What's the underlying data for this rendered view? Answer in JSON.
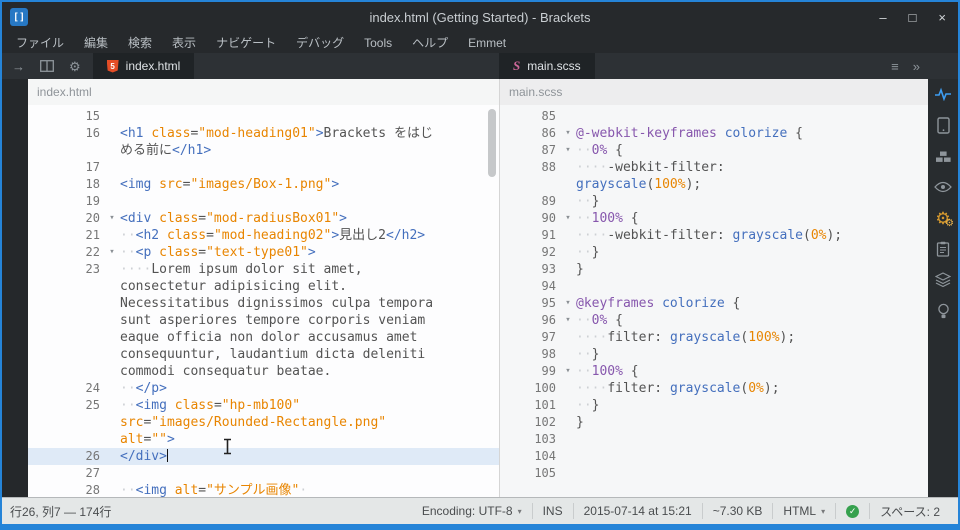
{
  "window": {
    "title": "index.html (Getting Started) - Brackets",
    "controls": {
      "minimize": "–",
      "maximize": "□",
      "close": "×"
    }
  },
  "menu": {
    "items": [
      "ファイル",
      "編集",
      "検索",
      "表示",
      "ナビゲート",
      "デバッグ",
      "Tools",
      "ヘルプ",
      "Emmet"
    ]
  },
  "tab_bar": {
    "left_tools": [
      {
        "name": "nav-forward-icon",
        "glyph": "→"
      },
      {
        "name": "split-view-icon",
        "glyph": "svg-split"
      },
      {
        "name": "settings-gear-icon",
        "glyph": "⚙"
      }
    ],
    "right_tools": [
      {
        "name": "working-files-list-icon",
        "glyph": "≡"
      },
      {
        "name": "overflow-chevrons-icon",
        "glyph": "»"
      }
    ]
  },
  "left_pane": {
    "tab_label": "index.html",
    "header_label": "index.html",
    "rows": [
      {
        "n": "15",
        "s": []
      },
      {
        "n": "16",
        "s": [
          [
            "<h1 ",
            "b"
          ],
          [
            "class",
            "o"
          ],
          [
            "=",
            "p"
          ],
          [
            "\"mod-heading01\"",
            "o"
          ],
          [
            ">",
            "b"
          ],
          [
            "Brackets をはじ",
            "p"
          ]
        ]
      },
      {
        "n": "",
        "s": [
          [
            "める前に",
            "p"
          ],
          [
            "</h1>",
            "b"
          ]
        ]
      },
      {
        "n": "17",
        "s": []
      },
      {
        "n": "18",
        "s": [
          [
            "<img ",
            "b"
          ],
          [
            "src",
            "o"
          ],
          [
            "=",
            "p"
          ],
          [
            "\"images/Box-1.png\"",
            "o"
          ],
          [
            ">",
            "b"
          ]
        ]
      },
      {
        "n": "19",
        "s": []
      },
      {
        "n": "20",
        "fold": 1,
        "s": [
          [
            "<div ",
            "b"
          ],
          [
            "class",
            "o"
          ],
          [
            "=",
            "p"
          ],
          [
            "\"mod-radiusBox01\"",
            "o"
          ],
          [
            ">",
            "b"
          ]
        ]
      },
      {
        "n": "21",
        "s": [
          [
            "··",
            "w"
          ],
          [
            "<h2 ",
            "b"
          ],
          [
            "class",
            "o"
          ],
          [
            "=",
            "p"
          ],
          [
            "\"mod-heading02\"",
            "o"
          ],
          [
            ">",
            "b"
          ],
          [
            "見出し2",
            "p"
          ],
          [
            "</h2>",
            "b"
          ]
        ]
      },
      {
        "n": "22",
        "fold": 1,
        "s": [
          [
            "··",
            "w"
          ],
          [
            "<p ",
            "b"
          ],
          [
            "class",
            "o"
          ],
          [
            "=",
            "p"
          ],
          [
            "\"text-type01\"",
            "o"
          ],
          [
            ">",
            "b"
          ]
        ]
      },
      {
        "n": "23",
        "s": [
          [
            "····",
            "w"
          ],
          [
            "Lorem ipsum dolor sit amet,",
            "p"
          ]
        ]
      },
      {
        "n": "",
        "s": [
          [
            "consectetur adipisicing elit.",
            "p"
          ]
        ]
      },
      {
        "n": "",
        "s": [
          [
            "Necessitatibus dignissimos culpa tempora",
            "p"
          ]
        ]
      },
      {
        "n": "",
        "s": [
          [
            "sunt asperiores tempore corporis veniam",
            "p"
          ]
        ]
      },
      {
        "n": "",
        "s": [
          [
            "eaque officia non dolor accusamus amet",
            "p"
          ]
        ]
      },
      {
        "n": "",
        "s": [
          [
            "consequuntur, laudantium dicta deleniti",
            "p"
          ]
        ]
      },
      {
        "n": "",
        "s": [
          [
            "commodi consequatur beatae.",
            "p"
          ]
        ]
      },
      {
        "n": "24",
        "s": [
          [
            "··",
            "w"
          ],
          [
            "</p>",
            "b"
          ]
        ]
      },
      {
        "n": "25",
        "s": [
          [
            "··",
            "w"
          ],
          [
            "<img ",
            "b"
          ],
          [
            "class",
            "o"
          ],
          [
            "=",
            "p"
          ],
          [
            "\"hp-mb100\"",
            "o"
          ]
        ]
      },
      {
        "n": "",
        "s": [
          [
            "src",
            "o"
          ],
          [
            "=",
            "p"
          ],
          [
            "\"images/Rounded-Rectangle.png\"",
            "o"
          ]
        ]
      },
      {
        "n": "",
        "s": [
          [
            "alt",
            "o"
          ],
          [
            "=",
            "p"
          ],
          [
            "\"\"",
            "o"
          ],
          [
            ">",
            "b"
          ]
        ]
      },
      {
        "n": "26",
        "active": 1,
        "caret": 1,
        "s": [
          [
            "</div>",
            "b"
          ]
        ]
      },
      {
        "n": "27",
        "s": []
      },
      {
        "n": "28",
        "s": [
          [
            "··",
            "w"
          ],
          [
            "<img ",
            "b"
          ],
          [
            "alt",
            "o"
          ],
          [
            "=",
            "p"
          ],
          [
            "\"サンプル画像\"",
            "o"
          ],
          [
            "·",
            "w"
          ]
        ]
      }
    ]
  },
  "right_pane": {
    "tab_label": "main.scss",
    "header_label": "main.scss",
    "rows": [
      {
        "n": "85",
        "s": []
      },
      {
        "n": "86",
        "fold": 1,
        "s": [
          [
            "@-webkit-keyframes",
            "v"
          ],
          [
            " ",
            "p"
          ],
          [
            "colorize",
            "b"
          ],
          [
            " {",
            "p"
          ]
        ]
      },
      {
        "n": "87",
        "fold": 1,
        "s": [
          [
            "··",
            "w"
          ],
          [
            "0%",
            "v"
          ],
          [
            " {",
            "p"
          ]
        ]
      },
      {
        "n": "88",
        "s": [
          [
            "····",
            "w"
          ],
          [
            "-webkit-filter:",
            "p"
          ]
        ]
      },
      {
        "n": "",
        "s": [
          [
            "grayscale",
            "b"
          ],
          [
            "(",
            "p"
          ],
          [
            "100%",
            "o"
          ],
          [
            ");",
            "p"
          ]
        ]
      },
      {
        "n": "89",
        "s": [
          [
            "··",
            "w"
          ],
          [
            "}",
            "p"
          ]
        ]
      },
      {
        "n": "90",
        "fold": 1,
        "s": [
          [
            "··",
            "w"
          ],
          [
            "100%",
            "v"
          ],
          [
            " {",
            "p"
          ]
        ]
      },
      {
        "n": "91",
        "s": [
          [
            "····",
            "w"
          ],
          [
            "-webkit-filter:",
            "p"
          ],
          [
            " ",
            "p"
          ],
          [
            "grayscale",
            "b"
          ],
          [
            "(",
            "p"
          ],
          [
            "0%",
            "o"
          ],
          [
            ");",
            "p"
          ]
        ]
      },
      {
        "n": "92",
        "s": [
          [
            "··",
            "w"
          ],
          [
            "}",
            "p"
          ]
        ]
      },
      {
        "n": "93",
        "s": [
          [
            "}",
            "p"
          ]
        ]
      },
      {
        "n": "94",
        "s": []
      },
      {
        "n": "95",
        "fold": 1,
        "s": [
          [
            "@keyframes",
            "v"
          ],
          [
            " ",
            "p"
          ],
          [
            "colorize",
            "b"
          ],
          [
            " {",
            "p"
          ]
        ]
      },
      {
        "n": "96",
        "fold": 1,
        "s": [
          [
            "··",
            "w"
          ],
          [
            "0%",
            "v"
          ],
          [
            " {",
            "p"
          ]
        ]
      },
      {
        "n": "97",
        "s": [
          [
            "····",
            "w"
          ],
          [
            "filter:",
            "p"
          ],
          [
            " ",
            "p"
          ],
          [
            "grayscale",
            "b"
          ],
          [
            "(",
            "p"
          ],
          [
            "100%",
            "o"
          ],
          [
            ");",
            "p"
          ]
        ]
      },
      {
        "n": "98",
        "s": [
          [
            "··",
            "w"
          ],
          [
            "}",
            "p"
          ]
        ]
      },
      {
        "n": "99",
        "fold": 1,
        "s": [
          [
            "··",
            "w"
          ],
          [
            "100%",
            "v"
          ],
          [
            " {",
            "p"
          ]
        ]
      },
      {
        "n": "100",
        "s": [
          [
            "····",
            "w"
          ],
          [
            "filter:",
            "p"
          ],
          [
            " ",
            "p"
          ],
          [
            "grayscale",
            "b"
          ],
          [
            "(",
            "p"
          ],
          [
            "0%",
            "o"
          ],
          [
            ");",
            "p"
          ]
        ]
      },
      {
        "n": "101",
        "s": [
          [
            "··",
            "w"
          ],
          [
            "}",
            "p"
          ]
        ]
      },
      {
        "n": "102",
        "s": [
          [
            "}",
            "p"
          ]
        ]
      },
      {
        "n": "103",
        "s": []
      },
      {
        "n": "104",
        "s": []
      },
      {
        "n": "105",
        "s": []
      }
    ]
  },
  "sidebar": {
    "icons": [
      {
        "name": "live-preview-pulse-icon",
        "type": "pulse"
      },
      {
        "name": "device-preview-icon",
        "type": "tablet"
      },
      {
        "name": "extensions-bricks-icon",
        "type": "bricks"
      },
      {
        "name": "visibility-eye-icon",
        "type": "eye"
      },
      {
        "name": "settings-gears-icon",
        "type": "gears"
      },
      {
        "name": "snippets-clipboard-icon",
        "type": "clipboard"
      },
      {
        "name": "layers-stack-icon",
        "type": "layers"
      },
      {
        "name": "hint-lightbulb-icon",
        "type": "bulb"
      }
    ]
  },
  "status_bar": {
    "position": "行26, 列7 — 174行",
    "items": [
      {
        "name": "encoding-selector",
        "label": "Encoding: UTF-8",
        "caret": true,
        "interactable": true
      },
      {
        "name": "insert-mode-indicator",
        "label": "INS",
        "interactable": true
      },
      {
        "name": "timestamp",
        "label": "2015-07-14 at 15:21",
        "interactable": false
      },
      {
        "name": "file-size",
        "label": "~7.30 KB",
        "interactable": false
      },
      {
        "name": "language-selector",
        "label": "HTML",
        "caret": true,
        "interactable": true
      },
      {
        "name": "lint-status",
        "check": true,
        "interactable": true
      },
      {
        "name": "indent-setting",
        "label": "スペース: 2",
        "interactable": true
      }
    ]
  },
  "colors": {
    "window_border": "#2584d8",
    "tag_blue": "#446fbd",
    "string_orange": "#e88501",
    "atrule_purple": "#8757ad",
    "plain_text": "#535353",
    "html_icon_orange": "#e44d26",
    "sass_icon_pink": "#cd6799",
    "lint_ok_green": "#36a14e",
    "active_line_blue": "#dfeaf7",
    "live_preview_blue": "#3d9df2"
  }
}
